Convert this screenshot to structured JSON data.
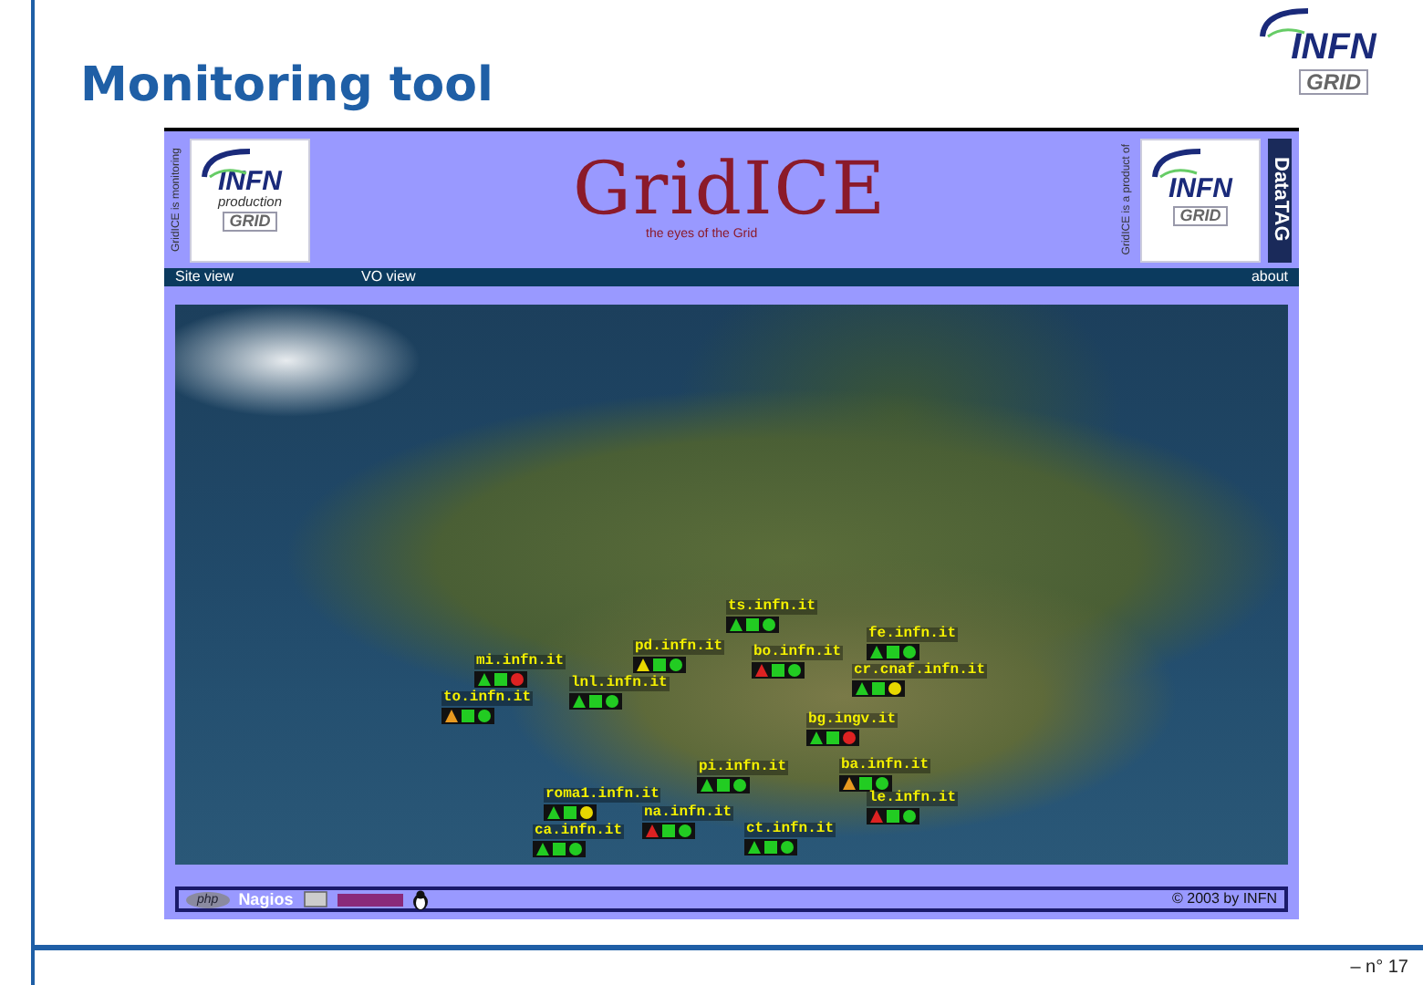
{
  "slide": {
    "title": "Monitoring tool",
    "logo": {
      "name": "INFN",
      "subtitle": "GRID"
    },
    "page_number": "– n° 17"
  },
  "screenshot": {
    "header": {
      "left_caption": "GridICE is monitoring",
      "left_logo": {
        "name": "INFN",
        "tagline": "production",
        "subtitle": "GRID"
      },
      "title": "GridICE",
      "tagline": "the eyes of the Grid",
      "right_caption": "GridICE is a product of",
      "right_logo": {
        "name": "INFN",
        "subtitle": "GRID"
      },
      "partner": "DataTAG"
    },
    "nav": [
      {
        "label": "Site view"
      },
      {
        "label": "VO view"
      },
      {
        "label": "about"
      }
    ],
    "map": {
      "sites": [
        {
          "name": "ts.infn.it",
          "indicators": [
            {
              "kind": "triangle",
              "color": "#22cc22"
            },
            {
              "kind": "square",
              "color": "#22cc22"
            },
            {
              "kind": "circle",
              "color": "#22cc22"
            }
          ]
        },
        {
          "name": "fe.infn.it",
          "indicators": [
            {
              "kind": "triangle",
              "color": "#22cc22"
            },
            {
              "kind": "square",
              "color": "#22cc22"
            },
            {
              "kind": "circle",
              "color": "#22cc22"
            }
          ]
        },
        {
          "name": "pd.infn.it",
          "indicators": [
            {
              "kind": "triangle",
              "color": "#e8d800"
            },
            {
              "kind": "square",
              "color": "#22cc22"
            },
            {
              "kind": "circle",
              "color": "#22cc22"
            }
          ]
        },
        {
          "name": "bo.infn.it",
          "indicators": [
            {
              "kind": "triangle",
              "color": "#dd2222"
            },
            {
              "kind": "square",
              "color": "#22cc22"
            },
            {
              "kind": "circle",
              "color": "#22cc22"
            }
          ]
        },
        {
          "name": "mi.infn.it",
          "indicators": [
            {
              "kind": "triangle",
              "color": "#22cc22"
            },
            {
              "kind": "square",
              "color": "#22cc22"
            },
            {
              "kind": "circle",
              "color": "#dd2222"
            }
          ]
        },
        {
          "name": "lnl.infn.it",
          "indicators": [
            {
              "kind": "triangle",
              "color": "#22cc22"
            },
            {
              "kind": "square",
              "color": "#22cc22"
            },
            {
              "kind": "circle",
              "color": "#22cc22"
            }
          ]
        },
        {
          "name": "cr.cnaf.infn.it",
          "indicators": [
            {
              "kind": "triangle",
              "color": "#22cc22"
            },
            {
              "kind": "square",
              "color": "#22cc22"
            },
            {
              "kind": "circle",
              "color": "#e8d800"
            }
          ]
        },
        {
          "name": "to.infn.it",
          "indicators": [
            {
              "kind": "triangle",
              "color": "#e89a20"
            },
            {
              "kind": "square",
              "color": "#22cc22"
            },
            {
              "kind": "circle",
              "color": "#22cc22"
            }
          ]
        },
        {
          "name": "bg.ingv.it",
          "indicators": [
            {
              "kind": "triangle",
              "color": "#22cc22"
            },
            {
              "kind": "square",
              "color": "#22cc22"
            },
            {
              "kind": "circle",
              "color": "#dd2222"
            }
          ]
        },
        {
          "name": "pi.infn.it",
          "indicators": [
            {
              "kind": "triangle",
              "color": "#22cc22"
            },
            {
              "kind": "square",
              "color": "#22cc22"
            },
            {
              "kind": "circle",
              "color": "#22cc22"
            }
          ]
        },
        {
          "name": "ba.infn.it",
          "indicators": [
            {
              "kind": "triangle",
              "color": "#e89a20"
            },
            {
              "kind": "square",
              "color": "#22cc22"
            },
            {
              "kind": "circle",
              "color": "#22cc22"
            }
          ]
        },
        {
          "name": "roma1.infn.it",
          "indicators": [
            {
              "kind": "triangle",
              "color": "#22cc22"
            },
            {
              "kind": "square",
              "color": "#22cc22"
            },
            {
              "kind": "circle",
              "color": "#e8d800"
            }
          ]
        },
        {
          "name": "le.infn.it",
          "indicators": [
            {
              "kind": "triangle",
              "color": "#dd2222"
            },
            {
              "kind": "square",
              "color": "#22cc22"
            },
            {
              "kind": "circle",
              "color": "#22cc22"
            }
          ]
        },
        {
          "name": "na.infn.it",
          "indicators": [
            {
              "kind": "triangle",
              "color": "#dd2222"
            },
            {
              "kind": "square",
              "color": "#22cc22"
            },
            {
              "kind": "circle",
              "color": "#22cc22"
            }
          ]
        },
        {
          "name": "ca.infn.it",
          "indicators": [
            {
              "kind": "triangle",
              "color": "#22cc22"
            },
            {
              "kind": "square",
              "color": "#22cc22"
            },
            {
              "kind": "circle",
              "color": "#22cc22"
            }
          ]
        },
        {
          "name": "ct.infn.it",
          "indicators": [
            {
              "kind": "triangle",
              "color": "#22cc22"
            },
            {
              "kind": "square",
              "color": "#22cc22"
            },
            {
              "kind": "circle",
              "color": "#22cc22"
            }
          ]
        }
      ]
    },
    "footer": {
      "badges": [
        "php",
        "Nagios"
      ],
      "copyright": "© 2003 by INFN"
    }
  }
}
